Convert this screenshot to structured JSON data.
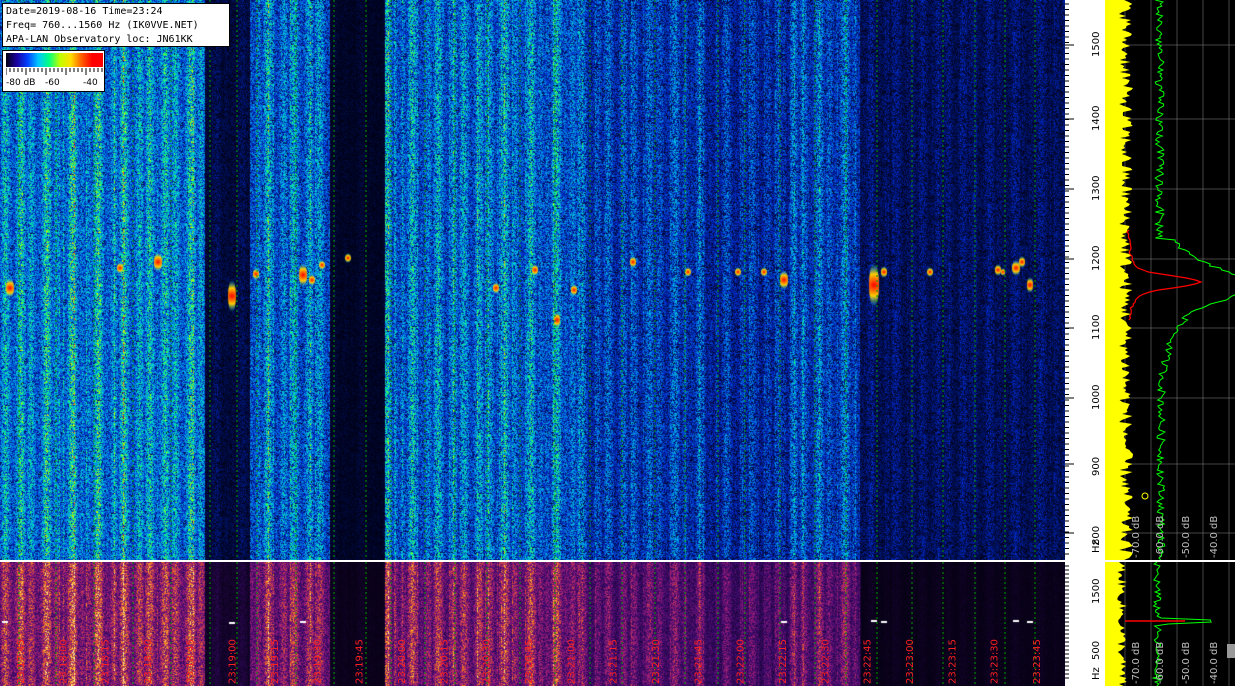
{
  "info": {
    "line1": "Date=2019-08-16 Time=23:24",
    "line2": "Freq= 760...1560 Hz (IK0VVE.NET)",
    "line3": "APA-LAN Observatory loc: JN61KK"
  },
  "color_scale": {
    "labels": [
      "-80 dB",
      "-60",
      "-40"
    ]
  },
  "freq_axis": {
    "ticks": [
      "1500",
      "1400",
      "1300",
      "1200",
      "1100",
      "1000",
      "900",
      "800"
    ],
    "unit": "Hz"
  },
  "freq_axis_bottom": {
    "ticks": [
      "1500",
      "500"
    ],
    "unit": "Hz"
  },
  "db_labels": [
    "-70.0 dB",
    "-60.0 dB",
    "-50.0 dB",
    "-40.0 dB"
  ],
  "time_labels": [
    "23:17:45",
    "23:18:00",
    "23:18:15",
    "23:18:30",
    "23:18:45",
    "23:19:00",
    "23:19:15",
    "23:19:30",
    "23:19:45",
    "23:20:00",
    "23:20:15",
    "23:20:30",
    "23:20:45",
    "23:21:00",
    "23:21:15",
    "23:21:30",
    "23:21:45",
    "23:22:00",
    "23:22:15",
    "23:22:30",
    "23:22:45",
    "23:23:00",
    "23:23:15",
    "23:23:30",
    "23:23:45"
  ],
  "colors": {
    "spectrum_yellow": "#ffff00",
    "spectrum_green": "#00ff00",
    "spectrum_red": "#ff0000",
    "time_label": "#ff2020",
    "grid_green": "#00a000"
  }
}
